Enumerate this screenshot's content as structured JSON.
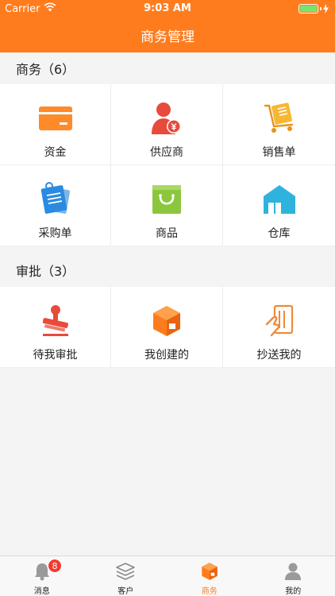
{
  "status": {
    "carrier": "Carrier",
    "time": "9:03 AM"
  },
  "nav": {
    "title": "商务管理"
  },
  "sections": [
    {
      "title": "商务（6）",
      "items": [
        {
          "label": "资金",
          "icon": "card-icon"
        },
        {
          "label": "供应商",
          "icon": "supplier-icon"
        },
        {
          "label": "销售单",
          "icon": "cart-icon"
        },
        {
          "label": "采购单",
          "icon": "clipboard-icon"
        },
        {
          "label": "商品",
          "icon": "bag-icon"
        },
        {
          "label": "仓库",
          "icon": "warehouse-icon"
        }
      ]
    },
    {
      "title": "审批（3）",
      "items": [
        {
          "label": "待我审批",
          "icon": "stamp-icon"
        },
        {
          "label": "我创建的",
          "icon": "box-icon"
        },
        {
          "label": "抄送我的",
          "icon": "hand-card-icon"
        }
      ]
    }
  ],
  "tabs": [
    {
      "label": "消息",
      "icon": "bell-icon",
      "badge": "8"
    },
    {
      "label": "客户",
      "icon": "layers-icon"
    },
    {
      "label": "商务",
      "icon": "box-icon",
      "active": true
    },
    {
      "label": "我的",
      "icon": "person-icon"
    }
  ],
  "colors": {
    "brand": "#ff7c1e",
    "badge": "#f23b30"
  }
}
